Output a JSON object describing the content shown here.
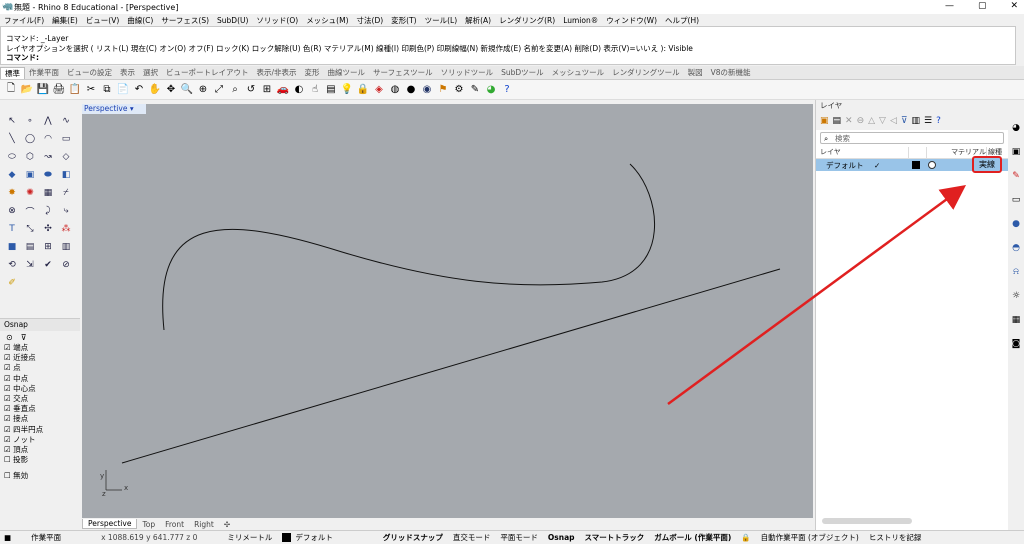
{
  "window": {
    "title": "無題 - Rhino 8 Educational - [Perspective]"
  },
  "menu": [
    "ファイル(F)",
    "編集(E)",
    "ビュー(V)",
    "曲線(C)",
    "サーフェス(S)",
    "SubD(U)",
    "ソリッド(O)",
    "メッシュ(M)",
    "寸法(D)",
    "変形(T)",
    "ツール(L)",
    "解析(A)",
    "レンダリング(R)",
    "Lumion®",
    "ウィンドウ(W)",
    "ヘルプ(H)"
  ],
  "command": {
    "line2": "コマンド: _-Layer",
    "line3": "レイヤオプションを選択 ( リスト(L)  現在(C)  オン(O)  オフ(F)  ロック(K)  ロック解除(U)  色(R)  マテリアル(M)  線種(I)  印刷色(P)  印刷線幅(N)  新規作成(E)  名前を変更(A)  削除(D)  表示(V)=いいえ ):  Visible",
    "prompt": "コマンド:"
  },
  "tabs": [
    "標準",
    "作業平面",
    "ビューの設定",
    "表示",
    "選択",
    "ビューポートレイアウト",
    "表示/非表示",
    "変形",
    "曲線ツール",
    "サーフェスツール",
    "ソリッドツール",
    "SubDツール",
    "メッシュツール",
    "レンダリングツール",
    "製図",
    "V8の新機能"
  ],
  "viewport": {
    "title": "Perspective",
    "axis_x": "x",
    "axis_y": "y",
    "axis_z": "z"
  },
  "viewtabs": [
    "Perspective",
    "Top",
    "Front",
    "Right"
  ],
  "osnap": {
    "title": "Osnap",
    "items": [
      {
        "label": "端点",
        "checked": true
      },
      {
        "label": "近接点",
        "checked": true
      },
      {
        "label": "点",
        "checked": true
      },
      {
        "label": "中点",
        "checked": true
      },
      {
        "label": "中心点",
        "checked": true
      },
      {
        "label": "交点",
        "checked": true
      },
      {
        "label": "垂直点",
        "checked": true
      },
      {
        "label": "接点",
        "checked": true
      },
      {
        "label": "四半円点",
        "checked": true
      },
      {
        "label": "ノット",
        "checked": true
      },
      {
        "label": "頂点",
        "checked": true
      },
      {
        "label": "投影",
        "checked": false
      }
    ],
    "disable": "無効"
  },
  "layers": {
    "title": "レイヤ",
    "search_placeholder": "検索",
    "col_layer": "レイヤ",
    "col_material": "マテリアル",
    "col_linetype": "線種",
    "row": {
      "name": "デフォルト",
      "check": "✓",
      "linetype": "実線",
      "color": "#000000"
    }
  },
  "status": {
    "cplane": "作業平面",
    "coords": "x 1088.619  y 641.777  z 0",
    "units": "ミリメートル",
    "layer": "デフォルト",
    "grid_snap": "グリッドスナップ",
    "ortho": "直交モード",
    "planar": "平面モード",
    "osnap": "Osnap",
    "smarttrack": "スマートトラック",
    "gumball": "ガムボール (作業平面)",
    "auto_cplane": "自動作業平面 (オブジェクト)",
    "history": "ヒストリを記録"
  },
  "colors": {
    "accent": "#e02020",
    "selection": "#99c4e8",
    "viewport_bg": "#a5a9ae"
  }
}
